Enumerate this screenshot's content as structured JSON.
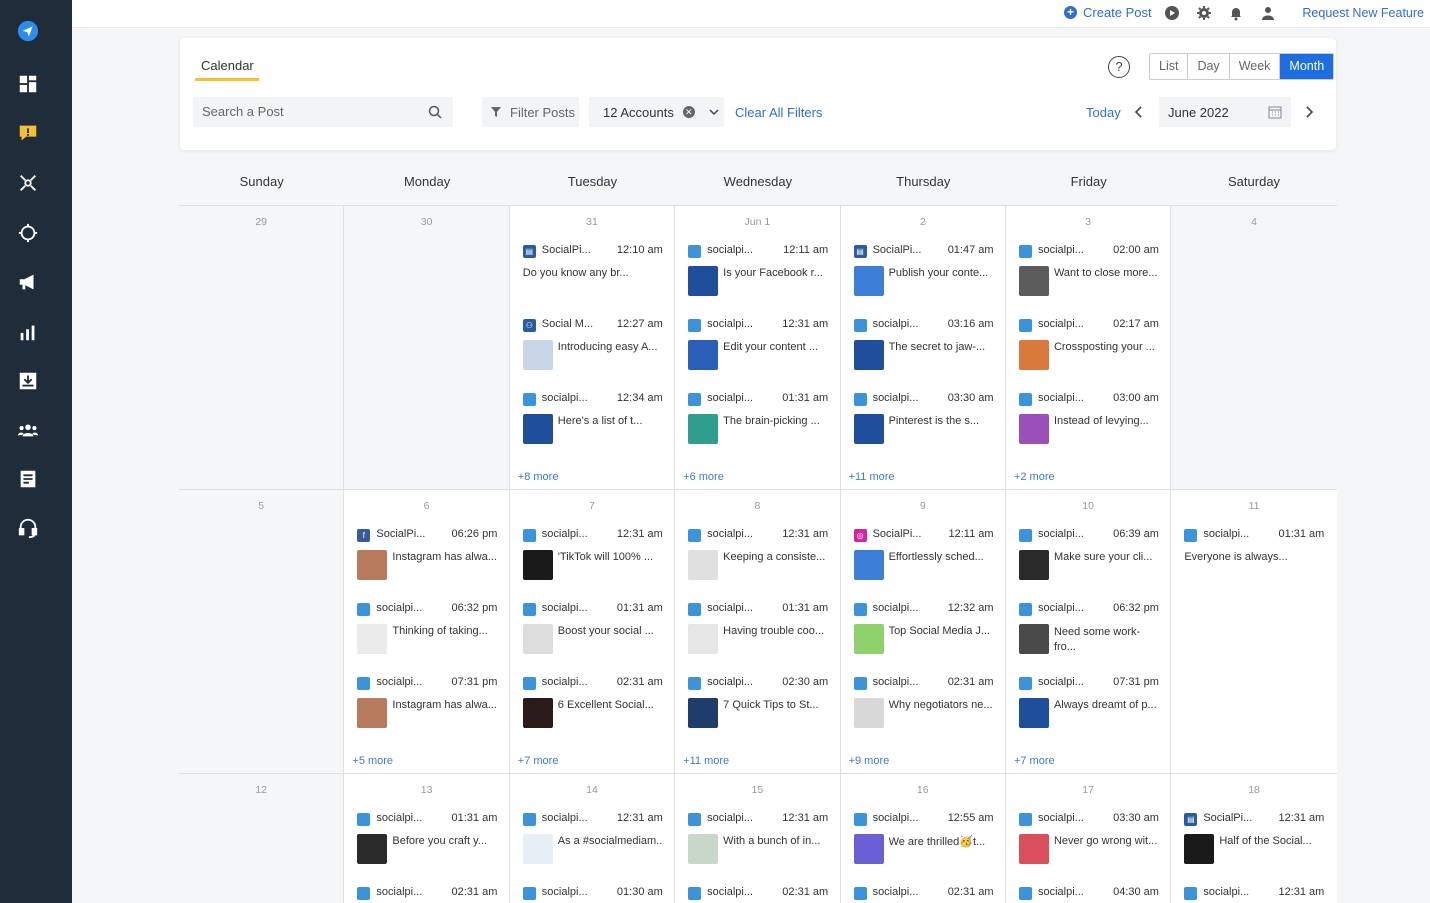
{
  "topbar": {
    "create_post": "Create Post",
    "request_feature": "Request New Feature"
  },
  "header": {
    "tab": "Calendar",
    "help": "?",
    "views": [
      "List",
      "Day",
      "Week",
      "Month"
    ],
    "active_view": "Month",
    "search_placeholder": "Search a Post",
    "filter_label": "Filter Posts",
    "accounts_label": "12 Accounts",
    "clear_filters": "Clear All Filters",
    "today": "Today",
    "month": "June 2022"
  },
  "colors": {
    "sidebar": "#1f2c3a",
    "accent": "#1d6ee0",
    "link": "#2c6fd6",
    "tab_underline": "#f2c230",
    "twitter": "#3b94d9",
    "facebook": "#3b5998",
    "instagram": "#d6249f",
    "page": "#2a5d9f"
  },
  "day_names": [
    "Sunday",
    "Monday",
    "Tuesday",
    "Wednesday",
    "Thursday",
    "Friday",
    "Saturday"
  ],
  "weeks": [
    {
      "days": [
        {
          "num": "29",
          "empty": true,
          "posts": []
        },
        {
          "num": "30",
          "empty": true,
          "posts": []
        },
        {
          "num": "31",
          "more": "+8 more",
          "posts": [
            {
              "icon": "page",
              "account": "SocialPi...",
              "time": "12:10 am",
              "text": "Do you know any br...",
              "thumb": null
            },
            {
              "icon": "group",
              "account": "Social M...",
              "time": "12:27 am",
              "text": "Introducing easy A...",
              "thumb": "#c9d6e8"
            },
            {
              "icon": "twitter",
              "account": "socialpi...",
              "time": "12:34 am",
              "text": "Here's a list of t...",
              "thumb": "#1f4f9a"
            }
          ]
        },
        {
          "num": "Jun 1",
          "more": "+6 more",
          "posts": [
            {
              "icon": "twitter",
              "account": "socialpi...",
              "time": "12:11 am",
              "text": "Is your Facebook r...",
              "thumb": "#1f4f9a"
            },
            {
              "icon": "twitter",
              "account": "socialpi...",
              "time": "12:31 am",
              "text": "Edit your content ...",
              "thumb": "#2a5fb8"
            },
            {
              "icon": "twitter",
              "account": "socialpi...",
              "time": "01:31 am",
              "text": "The brain-picking ...",
              "thumb": "#2f9e8e"
            }
          ]
        },
        {
          "num": "2",
          "more": "+11 more",
          "posts": [
            {
              "icon": "page",
              "account": "SocialPi...",
              "time": "01:47 am",
              "text": "Publish your conte...",
              "thumb": "#3b7fd6"
            },
            {
              "icon": "twitter",
              "account": "socialpi...",
              "time": "03:16 am",
              "text": "The secret to jaw-...",
              "thumb": "#1f4f9a"
            },
            {
              "icon": "twitter",
              "account": "socialpi...",
              "time": "03:30 am",
              "text": "Pinterest is the s...",
              "thumb": "#1f4f9a"
            }
          ]
        },
        {
          "num": "3",
          "more": "+2 more",
          "posts": [
            {
              "icon": "twitter",
              "account": "socialpi...",
              "time": "02:00 am",
              "text": "Want to close more...",
              "thumb": "#5c5c5c"
            },
            {
              "icon": "twitter",
              "account": "socialpi...",
              "time": "02:17 am",
              "text": "Crossposting your ...",
              "thumb": "#d97a3c"
            },
            {
              "icon": "twitter",
              "account": "socialpi...",
              "time": "03:00 am",
              "text": "Instead of levying...",
              "thumb": "#9b4fb8"
            }
          ]
        },
        {
          "num": "4",
          "empty": true,
          "posts": []
        }
      ]
    },
    {
      "days": [
        {
          "num": "5",
          "empty": true,
          "posts": []
        },
        {
          "num": "6",
          "more": "+5 more",
          "posts": [
            {
              "icon": "facebook",
              "account": "SocialPi...",
              "time": "06:26 pm",
              "text": "Instagram has alwa...",
              "thumb": "#b87a5c"
            },
            {
              "icon": "twitter",
              "account": "socialpi...",
              "time": "06:32 pm",
              "text": "Thinking of taking...",
              "thumb": "#ececec"
            },
            {
              "icon": "twitter",
              "account": "socialpi...",
              "time": "07:31 pm",
              "text": "Instagram has alwa...",
              "thumb": "#b87a5c"
            }
          ]
        },
        {
          "num": "7",
          "more": "+7 more",
          "posts": [
            {
              "icon": "twitter",
              "account": "socialpi...",
              "time": "12:31 am",
              "text": "'TikTok will 100% ...",
              "thumb": "#1a1a1a"
            },
            {
              "icon": "twitter",
              "account": "socialpi...",
              "time": "01:31 am",
              "text": "Boost your social ...",
              "thumb": "#dcdcdc"
            },
            {
              "icon": "twitter",
              "account": "socialpi...",
              "time": "02:31 am",
              "text": "6 Excellent Social...",
              "thumb": "#2a1a1a"
            }
          ]
        },
        {
          "num": "8",
          "more": "+11 more",
          "posts": [
            {
              "icon": "twitter",
              "account": "socialpi...",
              "time": "12:31 am",
              "text": "Keeping a consiste...",
              "thumb": "#e0e0e0"
            },
            {
              "icon": "twitter",
              "account": "socialpi...",
              "time": "01:31 am",
              "text": "Having trouble coo...",
              "thumb": "#e6e6e6"
            },
            {
              "icon": "twitter",
              "account": "socialpi...",
              "time": "02:30 am",
              "text": "7 Quick Tips to St...",
              "thumb": "#1f3d6b"
            }
          ]
        },
        {
          "num": "9",
          "more": "+9 more",
          "posts": [
            {
              "icon": "instagram",
              "account": "SocialPi...",
              "time": "12:11 am",
              "text": "Effortlessly sched...",
              "thumb": "#3b7fd6"
            },
            {
              "icon": "twitter",
              "account": "socialpi...",
              "time": "12:32 am",
              "text": "Top Social Media J...",
              "thumb": "#8fd16b"
            },
            {
              "icon": "twitter",
              "account": "socialpi...",
              "time": "02:31 am",
              "text": "Why negotiators ne...",
              "thumb": "#d8d8d8"
            }
          ]
        },
        {
          "num": "10",
          "more": "+7 more",
          "posts": [
            {
              "icon": "twitter",
              "account": "socialpi...",
              "time": "06:39 am",
              "text": "Make sure your cli...",
              "thumb": "#2a2a2a"
            },
            {
              "icon": "twitter",
              "account": "socialpi...",
              "time": "06:32 pm",
              "text": "Need some work-fro...",
              "thumb": "#4a4a4a",
              "wrap": true
            },
            {
              "icon": "twitter",
              "account": "socialpi...",
              "time": "07:31 pm",
              "text": "Always dreamt of p...",
              "thumb": "#1f4f9a"
            }
          ]
        },
        {
          "num": "11",
          "posts": [
            {
              "icon": "twitter",
              "account": "socialpi...",
              "time": "01:31 am",
              "text": "Everyone is always...",
              "thumb": null
            }
          ]
        }
      ]
    },
    {
      "days": [
        {
          "num": "12",
          "empty": true,
          "posts": []
        },
        {
          "num": "13",
          "posts": [
            {
              "icon": "twitter",
              "account": "socialpi...",
              "time": "01:31 am",
              "text": "Before you craft y...",
              "thumb": "#2a2a2a"
            },
            {
              "icon": "twitter",
              "account": "socialpi...",
              "time": "02:31 am",
              "text": "",
              "thumb": null
            }
          ]
        },
        {
          "num": "14",
          "posts": [
            {
              "icon": "twitter",
              "account": "socialpi...",
              "time": "12:31 am",
              "text": "As a #socialmediam...",
              "thumb": "#e8eef6"
            },
            {
              "icon": "twitter",
              "account": "socialpi...",
              "time": "01:30 am",
              "text": "",
              "thumb": null
            }
          ]
        },
        {
          "num": "15",
          "posts": [
            {
              "icon": "twitter",
              "account": "socialpi...",
              "time": "12:31 am",
              "text": "With a bunch of in...",
              "thumb": "#c8d8c8"
            },
            {
              "icon": "twitter",
              "account": "socialpi...",
              "time": "02:31 am",
              "text": "",
              "thumb": null
            }
          ]
        },
        {
          "num": "16",
          "posts": [
            {
              "icon": "twitter",
              "account": "socialpi...",
              "time": "12:55 am",
              "text": "We are thrilled🥳t...",
              "thumb": "#6b5fd6"
            },
            {
              "icon": "twitter",
              "account": "socialpi...",
              "time": "02:31 am",
              "text": "",
              "thumb": null
            }
          ]
        },
        {
          "num": "17",
          "posts": [
            {
              "icon": "twitter",
              "account": "socialpi...",
              "time": "03:30 am",
              "text": "Never go wrong wit...",
              "thumb": "#d94f5c"
            },
            {
              "icon": "twitter",
              "account": "socialpi...",
              "time": "04:30 am",
              "text": "",
              "thumb": null
            }
          ]
        },
        {
          "num": "18",
          "posts": [
            {
              "icon": "page",
              "account": "SocialPi...",
              "time": "12:31 am",
              "text": "Half of the Social...",
              "thumb": "#1a1a1a"
            },
            {
              "icon": "twitter",
              "account": "socialpi...",
              "time": "12:31 am",
              "text": "",
              "thumb": null
            }
          ]
        }
      ]
    }
  ]
}
